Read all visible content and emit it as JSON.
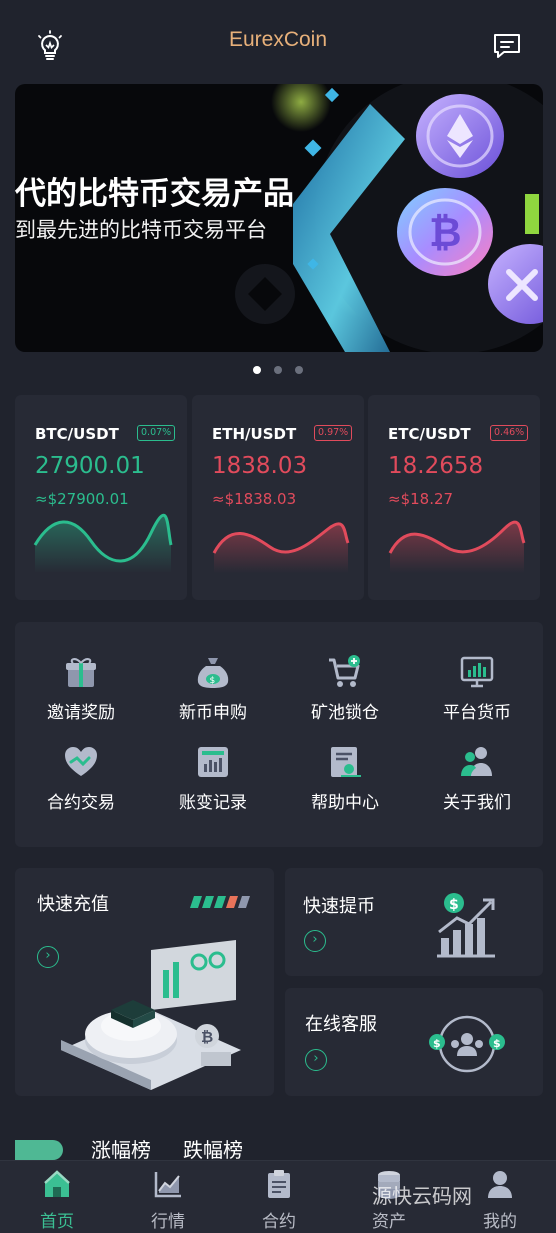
{
  "header": {
    "title": "EurexCoin",
    "left_icon": "lightbulb-icon",
    "right_icon": "message-icon"
  },
  "banner": {
    "title": "代的比特币交易产品",
    "subtitle": "到最先进的比特币交易平台",
    "slide_count": 3,
    "active_slide": 1
  },
  "tickers": [
    {
      "pair": "BTC/USDT",
      "change": "0.07%",
      "price": "27900.01",
      "usd": "≈$27900.01",
      "trend": "up"
    },
    {
      "pair": "ETH/USDT",
      "change": "0.97%",
      "price": "1838.03",
      "usd": "≈$1838.03",
      "trend": "down"
    },
    {
      "pair": "ETC/USDT",
      "change": "0.46%",
      "price": "18.2658",
      "usd": "≈$18.27",
      "trend": "down"
    }
  ],
  "features": [
    {
      "label": "邀请奖励",
      "icon": "gift-icon"
    },
    {
      "label": "新币申购",
      "icon": "money-bag-icon"
    },
    {
      "label": "矿池锁仓",
      "icon": "cart-icon"
    },
    {
      "label": "平台货币",
      "icon": "monitor-chart-icon"
    },
    {
      "label": "合约交易",
      "icon": "handshake-heart-icon"
    },
    {
      "label": "账变记录",
      "icon": "ledger-icon"
    },
    {
      "label": "帮助中心",
      "icon": "help-document-icon"
    },
    {
      "label": "关于我们",
      "icon": "users-icon"
    }
  ],
  "quick": {
    "deposit": "快速充值",
    "withdraw": "快速提币",
    "support": "在线客服",
    "arrow_icon": "chevron-right-icon"
  },
  "rankings": {
    "gainers": "涨幅榜",
    "losers": "跌幅榜"
  },
  "nav": [
    {
      "label": "首页",
      "icon": "home-icon",
      "active": true
    },
    {
      "label": "行情",
      "icon": "market-chart-icon",
      "active": false
    },
    {
      "label": "合约",
      "icon": "clipboard-icon",
      "active": false
    },
    {
      "label": "资产",
      "icon": "coins-icon",
      "active": false
    },
    {
      "label": "我的",
      "icon": "profile-icon",
      "active": false
    }
  ],
  "watermark": "源快云码网",
  "colors": {
    "up": "#2bbd8e",
    "down": "#e14b5c",
    "brand": "#e7b07a",
    "background": "#20232d",
    "card": "#272a35"
  }
}
